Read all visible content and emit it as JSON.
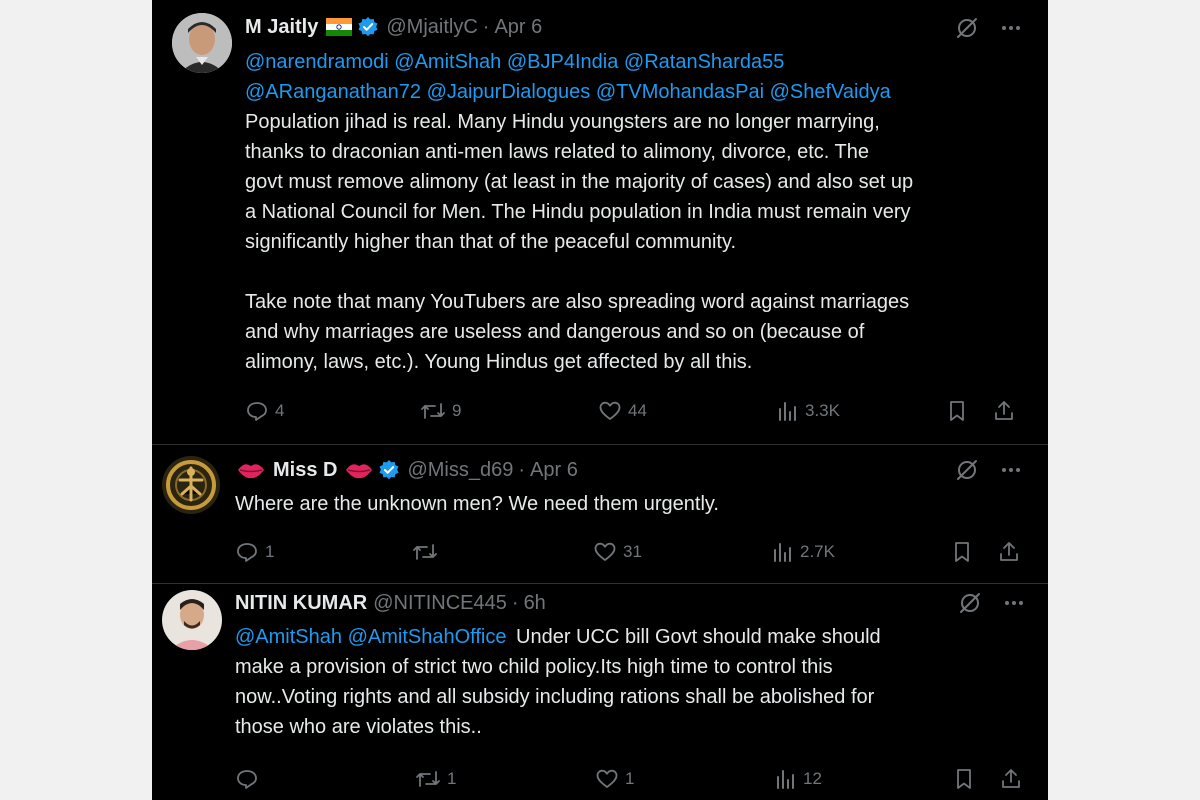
{
  "tweets": [
    {
      "name": "M Jaitly",
      "handle": "@MjaitlyC",
      "separator": "·",
      "date": "Apr 6",
      "mentions": [
        "@narendramodi",
        "@AmitShah",
        "@BJP4India",
        "@RatanSharda55",
        "@ARanganathan72",
        "@JaipurDialogues",
        "@TVMohandasPai",
        "@ShefVaidya"
      ],
      "para1_lines": [
        "Population jihad is real. Many Hindu youngsters are no longer marrying,",
        "thanks to draconian anti-men laws related to alimony, divorce, etc. The",
        "govt must remove alimony (at least in the majority of cases) and also set up",
        "a National Council for Men. The Hindu population in India must remain very",
        "significantly higher than that of the peaceful community."
      ],
      "para2_lines": [
        "Take note that many YouTubers are also spreading word against marriages",
        "and why marriages are useless and dangerous and so on (because of",
        "alimony, laws, etc.). Young Hindus get affected by all this."
      ],
      "replies": "4",
      "retweets": "9",
      "likes": "44",
      "views": "3.3K"
    },
    {
      "name": "Miss D",
      "handle": "@Miss_d69",
      "separator": "·",
      "date": "Apr 6",
      "text": "Where are the unknown men? We need them urgently.",
      "replies": "1",
      "retweets": "",
      "likes": "31",
      "views": "2.7K"
    },
    {
      "name": "NITIN KUMAR",
      "handle": "@NITINCE445",
      "separator": "·",
      "date": "6h",
      "mentions": [
        "@AmitShah",
        "@AmitShahOffice"
      ],
      "lines": [
        "Under UCC bill Govt should make should",
        "make a provision of strict two child policy.Its high time to control this",
        "now..Voting rights and all subsidy including rations shall be abolished for",
        "those who are violates this.."
      ],
      "replies": "",
      "retweets": "1",
      "likes": "1",
      "views": "12"
    }
  ],
  "colors": {
    "background": "#000000",
    "text": "#e7e9ea",
    "muted": "#71767b",
    "link": "#1d9bf0",
    "verified": "#1d9bf0",
    "divider": "#2f3336"
  },
  "icons": [
    "verified-badge-icon",
    "india-flag-icon",
    "lips-icon",
    "grok-icon",
    "more-icon",
    "reply-icon",
    "retweet-icon",
    "like-icon",
    "views-icon",
    "bookmark-icon",
    "share-icon"
  ]
}
